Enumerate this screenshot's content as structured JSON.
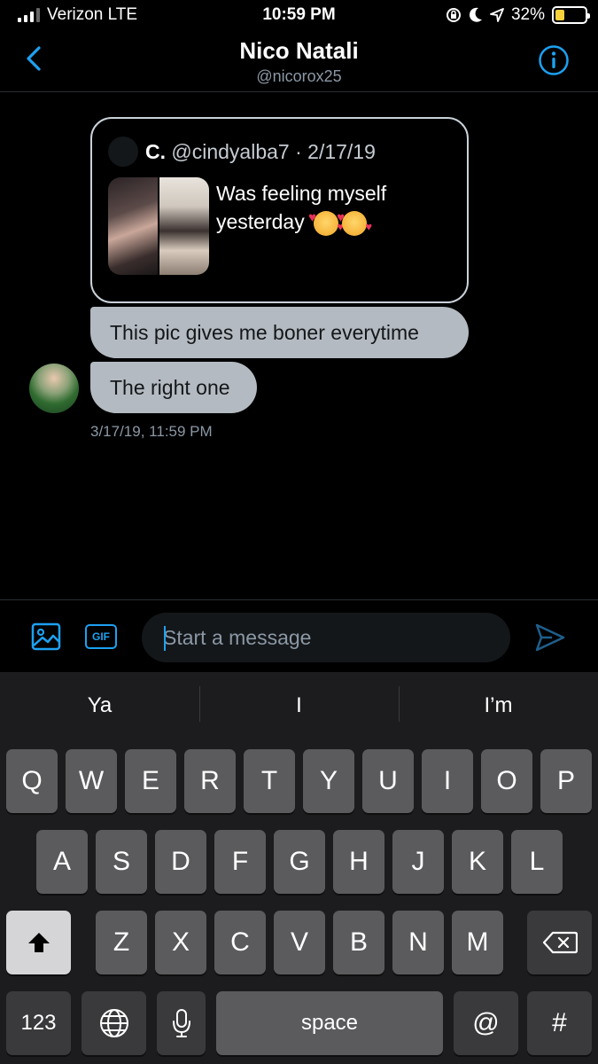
{
  "status_bar": {
    "carrier": "Verizon LTE",
    "time": "10:59 PM",
    "battery": "32%",
    "battery_level": 0.32
  },
  "header": {
    "title": "Nico Natali",
    "handle": "@nicorox25"
  },
  "quoted_tweet": {
    "name": "C.",
    "meta": "@cindyalba7 · 2/17/19",
    "text": "Was feeling myself yesterday"
  },
  "messages": [
    {
      "text": "This pic gives me boner everytime"
    },
    {
      "text": "The right one"
    }
  ],
  "timestamp": "3/17/19, 11:59 PM",
  "composer": {
    "placeholder": "Start a message",
    "gif_label": "GIF"
  },
  "keyboard": {
    "suggestions": [
      "Ya",
      "I",
      "I’m"
    ],
    "row1": [
      "Q",
      "W",
      "E",
      "R",
      "T",
      "Y",
      "U",
      "I",
      "O",
      "P"
    ],
    "row2": [
      "A",
      "S",
      "D",
      "F",
      "G",
      "H",
      "J",
      "K",
      "L"
    ],
    "row3": [
      "Z",
      "X",
      "C",
      "V",
      "B",
      "N",
      "M"
    ],
    "numbers_label": "123",
    "space_label": "space",
    "at_label": "@",
    "hash_label": "#"
  },
  "colors": {
    "accent": "#1da1f2",
    "bubble": "#b4bac1",
    "background": "#000000",
    "battery_fill": "#f7d23c"
  }
}
